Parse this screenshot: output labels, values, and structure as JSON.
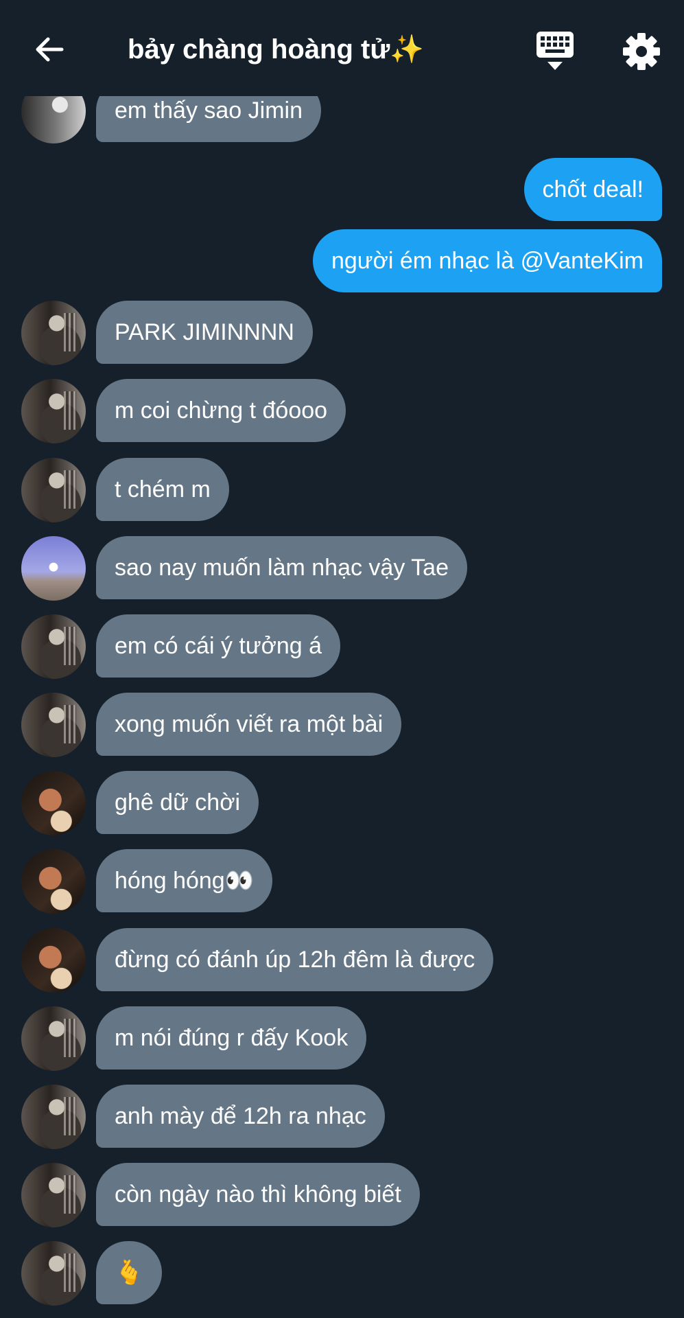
{
  "header": {
    "title": "bảy chàng hoàng tử✨",
    "back_icon": "arrow-left-icon",
    "keyboard_icon": "keyboard-hide-icon",
    "settings_icon": "gear-icon"
  },
  "colors": {
    "background": "#15202b",
    "incoming_bubble": "#657786",
    "outgoing_bubble": "#1da1f2"
  },
  "messages": [
    {
      "direction": "in",
      "avatar": "avatar-4",
      "text": "em thấy sao Jimin"
    },
    {
      "direction": "out",
      "avatar": "",
      "text": "chốt deal!"
    },
    {
      "direction": "out",
      "avatar": "",
      "text": "người ém nhạc là @VanteKim"
    },
    {
      "direction": "in",
      "avatar": "avatar-1",
      "text": "PARK JIMINNNN"
    },
    {
      "direction": "in",
      "avatar": "avatar-1",
      "text": "m coi chừng t đóooo"
    },
    {
      "direction": "in",
      "avatar": "avatar-1",
      "text": "t chém m"
    },
    {
      "direction": "in",
      "avatar": "avatar-2",
      "text": "sao nay muốn làm nhạc vậy Tae"
    },
    {
      "direction": "in",
      "avatar": "avatar-1",
      "text": "em có cái ý tưởng á"
    },
    {
      "direction": "in",
      "avatar": "avatar-1",
      "text": "xong muốn viết ra một bài"
    },
    {
      "direction": "in",
      "avatar": "avatar-3",
      "text": "ghê dữ chời"
    },
    {
      "direction": "in",
      "avatar": "avatar-3",
      "text": "hóng hóng👀"
    },
    {
      "direction": "in",
      "avatar": "avatar-3",
      "text": "đừng có đánh úp 12h đêm là được"
    },
    {
      "direction": "in",
      "avatar": "avatar-1",
      "text": "m nói đúng r đấy Kook"
    },
    {
      "direction": "in",
      "avatar": "avatar-1",
      "text": "anh mày để 12h ra nhạc"
    },
    {
      "direction": "in",
      "avatar": "avatar-1",
      "text": "còn ngày nào thì không biết"
    },
    {
      "direction": "in",
      "avatar": "avatar-1",
      "text": "🫰"
    }
  ]
}
